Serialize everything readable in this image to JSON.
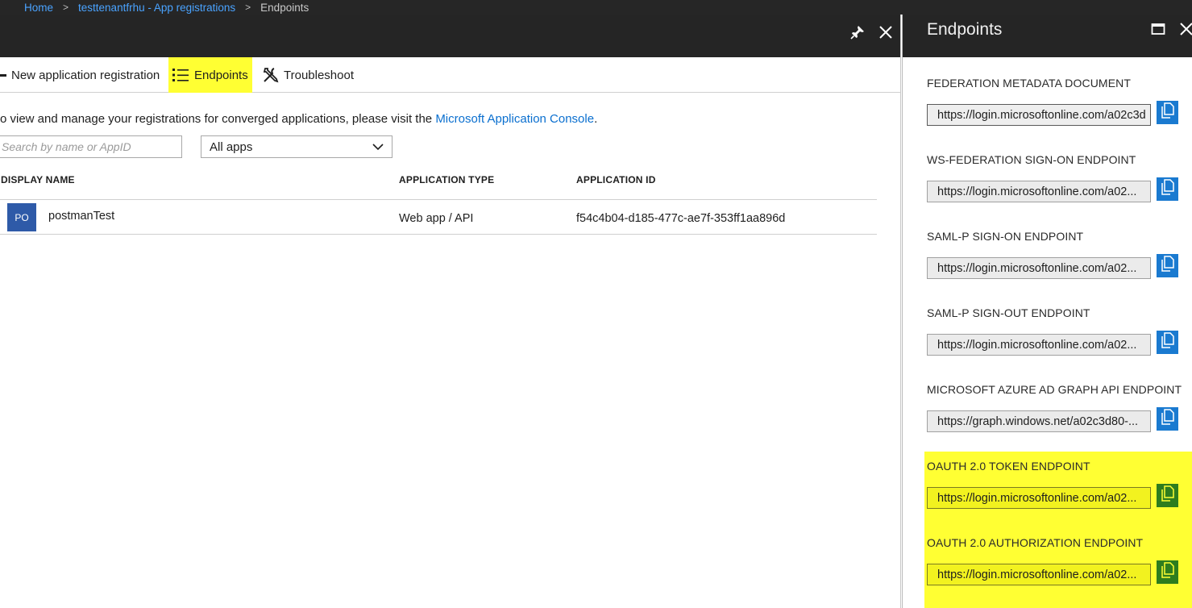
{
  "breadcrumb": {
    "home": "Home",
    "parent": "testtenantfrhu - App registrations",
    "current": "Endpoints",
    "separator": ">"
  },
  "left": {
    "commands": {
      "new_registration": "New application registration",
      "endpoints": "Endpoints",
      "troubleshoot": "Troubleshoot"
    },
    "info": {
      "text": "o view and manage your registrations for converged applications, please visit the ",
      "link": "Microsoft Application Console",
      "suffix": "."
    },
    "search": {
      "placeholder": "Search by name or AppID"
    },
    "filter": {
      "selected": "All apps"
    },
    "table": {
      "headers": [
        "DISPLAY NAME",
        "APPLICATION TYPE",
        "APPLICATION ID"
      ],
      "rows": [
        {
          "initials": "PO",
          "name": "postmanTest",
          "type": "Web app / API",
          "id": "f54c4b04-d185-477c-ae7f-353ff1aa896d"
        }
      ]
    }
  },
  "right": {
    "title": "Endpoints",
    "endpoints": [
      {
        "label": "FEDERATION METADATA DOCUMENT",
        "value": "https://login.microsoftonline.com/a02c3d",
        "highlighted": false
      },
      {
        "label": "WS-FEDERATION SIGN-ON ENDPOINT",
        "value": "https://login.microsoftonline.com/a02...",
        "highlighted": false
      },
      {
        "label": "SAML-P SIGN-ON ENDPOINT",
        "value": "https://login.microsoftonline.com/a02...",
        "highlighted": false
      },
      {
        "label": "SAML-P SIGN-OUT ENDPOINT",
        "value": "https://login.microsoftonline.com/a02...",
        "highlighted": false
      },
      {
        "label": "MICROSOFT AZURE AD GRAPH API ENDPOINT",
        "value": "https://graph.windows.net/a02c3d80-...",
        "highlighted": false
      },
      {
        "label": "OAUTH 2.0 TOKEN ENDPOINT",
        "value": "https://login.microsoftonline.com/a02...",
        "highlighted": true
      },
      {
        "label": "OAUTH 2.0 AUTHORIZATION ENDPOINT",
        "value": "https://login.microsoftonline.com/a02...",
        "highlighted": true
      }
    ]
  },
  "colors": {
    "header_bg": "#252525",
    "highlight": "#ffff33",
    "link": "#0a6fcf",
    "copy_button": "#1a7ad0",
    "copy_button_highlight": "#2e7d1e"
  }
}
